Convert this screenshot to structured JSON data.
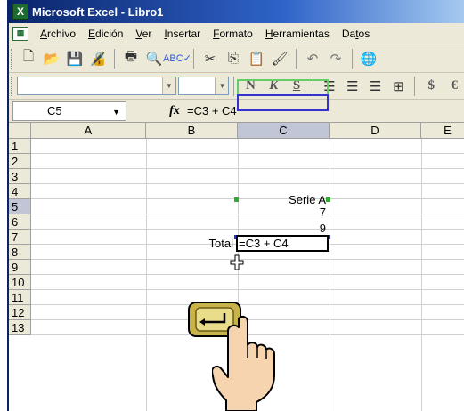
{
  "window": {
    "title": "Microsoft Excel - Libro1",
    "app_icon_letter": "X"
  },
  "menu": {
    "items": [
      "Archivo",
      "Edición",
      "Ver",
      "Insertar",
      "Formato",
      "Herramientas",
      "Datos"
    ],
    "mnemonics": [
      "A",
      "E",
      "V",
      "I",
      "F",
      "H",
      "t"
    ]
  },
  "toolbar": {
    "standard_icons": [
      "new-icon",
      "open-icon",
      "save-icon",
      "permission-icon",
      "print-icon",
      "print-preview-icon",
      "spelling-icon",
      "cut-icon",
      "copy-icon",
      "paste-icon",
      "format-painter-icon",
      "undo-icon",
      "redo-icon",
      "hyperlink-icon"
    ],
    "format_labels": {
      "bold": "N",
      "italic": "K",
      "underline": "S",
      "currency": "$",
      "euro": "€"
    }
  },
  "formula_bar": {
    "name_box": "C5",
    "fx": "fx",
    "formula": "=C3 + C4"
  },
  "sheet": {
    "columns": [
      "A",
      "B",
      "C",
      "D",
      "E"
    ],
    "selected_column": "C",
    "rows": [
      "1",
      "2",
      "3",
      "4",
      "5",
      "6",
      "7",
      "8",
      "9",
      "10",
      "11",
      "12",
      "13"
    ],
    "selected_row": "5",
    "cells": {
      "C2": "Serie A",
      "C3": "7",
      "C4": "9",
      "B5": "Total",
      "C5": "=C3 + C4"
    }
  },
  "overlay": {
    "description_icons": [
      "cursor-icon",
      "enter-key-icon",
      "pointing-hand-icon"
    ]
  },
  "colors": {
    "title_start": "#0a246a",
    "title_end": "#a6caf0",
    "range1_border": "#66cc66",
    "range2_border": "#3333cc",
    "header_selected": "#c1c6d6"
  }
}
